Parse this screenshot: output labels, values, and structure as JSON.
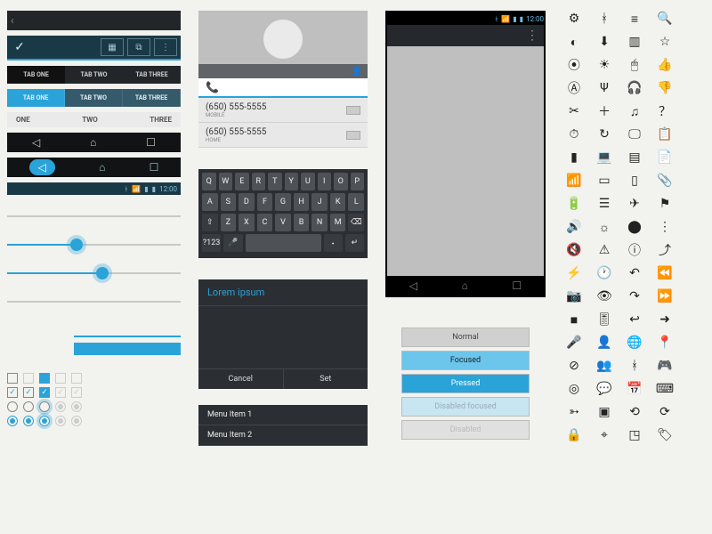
{
  "tabs_dark": {
    "t1": "TAB ONE",
    "t2": "TAB TWO",
    "t3": "TAB THREE"
  },
  "tabs_blue": {
    "t1": "TAB ONE",
    "t2": "TAB TWO",
    "t3": "TAB THREE"
  },
  "scroll_tabs": {
    "a": "ONE",
    "b": "TWO",
    "c": "THREE"
  },
  "status": {
    "time": "12:00"
  },
  "contact": {
    "phone1_num": "(650) 555-5555",
    "phone1_type": "MOBILE",
    "phone2_num": "(650) 555-5555",
    "phone2_type": "HOME"
  },
  "keyboard": {
    "r1": [
      "Q",
      "W",
      "E",
      "R",
      "T",
      "Y",
      "U",
      "I",
      "O",
      "P"
    ],
    "r2": [
      "A",
      "S",
      "D",
      "F",
      "G",
      "H",
      "J",
      "K",
      "L"
    ],
    "r3": [
      "⇧",
      "Z",
      "X",
      "C",
      "V",
      "B",
      "N",
      "M",
      "⌫"
    ],
    "r4": [
      "?123",
      "🎤",
      "",
      "・",
      "↵"
    ]
  },
  "dialog": {
    "title": "Lorem ipsum",
    "cancel": "Cancel",
    "set": "Set"
  },
  "menu": {
    "i1": "Menu Item 1",
    "i2": "Menu Item 2"
  },
  "phone_status": {
    "time": "12:00"
  },
  "buttons": {
    "normal": "Normal",
    "focused": "Focused",
    "pressed": "Pressed",
    "disabled_focused": "Disabled focused",
    "disabled": "Disabled"
  },
  "icons": [
    "settings-icon",
    "bluetooth-icon",
    "filter-icon",
    "search-icon",
    "contrast-icon",
    "download-icon",
    "barcode-icon",
    "star-icon",
    "world-icon",
    "brightness-icon",
    "mouse-icon",
    "thumbs-up-icon",
    "autofix-icon",
    "usb-icon",
    "headset-icon",
    "thumbs-down-icon",
    "crop-icon",
    "add-icon",
    "headphones-icon",
    "help-icon",
    "timer-icon",
    "refresh-icon",
    "monitor-icon",
    "clipboard-icon",
    "signal-icon",
    "laptop-icon",
    "sdcard-icon",
    "document-icon",
    "wifi-icon",
    "tv-icon",
    "phone-portrait-icon",
    "attachment-icon",
    "battery-icon",
    "server-icon",
    "airplane-icon",
    "flag-icon",
    "volume-icon",
    "brightness-low-icon",
    "alert-icon",
    "overflow-icon",
    "volume-mute-icon",
    "warning-icon",
    "info-icon",
    "share-icon",
    "flash-icon",
    "clock-icon",
    "undo-icon",
    "rewind-icon",
    "camera-icon",
    "eye-icon",
    "redo-icon",
    "fastforward-icon",
    "videocam-icon",
    "sliders-icon",
    "reply-icon",
    "forward-icon",
    "mic-off-icon",
    "person-icon",
    "globe-icon",
    "location-icon",
    "cancel-icon",
    "people-icon",
    "bluetooth-on-icon",
    "gamepad-icon",
    "target-icon",
    "chat-icon",
    "calendar-icon",
    "keyboard-icon",
    "compass-icon",
    "picture-icon",
    "rotate-left-icon",
    "rotate-right-icon",
    "lock-icon",
    "locate-icon",
    "crop2-icon",
    "label-icon"
  ],
  "glyphs": {
    "settings-icon": "⚙",
    "bluetooth-icon": "ᚼ",
    "filter-icon": "≡",
    "search-icon": "🔍",
    "contrast-icon": "◐",
    "download-icon": "⬇",
    "barcode-icon": "▥",
    "star-icon": "☆",
    "world-icon": "⦿",
    "brightness-icon": "☀",
    "mouse-icon": "🖱",
    "thumbs-up-icon": "👍",
    "autofix-icon": "Ⓐ",
    "usb-icon": "Ψ",
    "headset-icon": "🎧",
    "thumbs-down-icon": "👎",
    "crop-icon": "✂",
    "add-icon": "＋",
    "headphones-icon": "♫",
    "help-icon": "？",
    "timer-icon": "⏱",
    "refresh-icon": "↻",
    "monitor-icon": "🖵",
    "clipboard-icon": "📋",
    "signal-icon": "▮",
    "laptop-icon": "💻",
    "sdcard-icon": "▤",
    "document-icon": "📄",
    "wifi-icon": "📶",
    "tv-icon": "▭",
    "phone-portrait-icon": "▯",
    "attachment-icon": "📎",
    "battery-icon": "🔋",
    "server-icon": "☰",
    "airplane-icon": "✈",
    "flag-icon": "⚑",
    "volume-icon": "🔊",
    "brightness-low-icon": "☼",
    "alert-icon": "⬤",
    "overflow-icon": "⋮",
    "volume-mute-icon": "🔇",
    "warning-icon": "⚠",
    "info-icon": "ⓘ",
    "share-icon": "⤴",
    "flash-icon": "⚡",
    "clock-icon": "🕐",
    "undo-icon": "↶",
    "rewind-icon": "⏪",
    "camera-icon": "📷",
    "eye-icon": "👁",
    "redo-icon": "↷",
    "fastforward-icon": "⏩",
    "videocam-icon": "■",
    "sliders-icon": "🎚",
    "reply-icon": "↩",
    "forward-icon": "➜",
    "mic-off-icon": "🎤",
    "person-icon": "👤",
    "globe-icon": "🌐",
    "location-icon": "📍",
    "cancel-icon": "⊘",
    "people-icon": "👥",
    "bluetooth-on-icon": "ᚼ",
    "gamepad-icon": "🎮",
    "target-icon": "◎",
    "chat-icon": "💬",
    "calendar-icon": "📅",
    "keyboard-icon": "⌨",
    "compass-icon": "➳",
    "picture-icon": "▣",
    "rotate-left-icon": "⟲",
    "rotate-right-icon": "⟳",
    "lock-icon": "🔒",
    "locate-icon": "⌖",
    "crop2-icon": "◳",
    "label-icon": "🏷"
  }
}
